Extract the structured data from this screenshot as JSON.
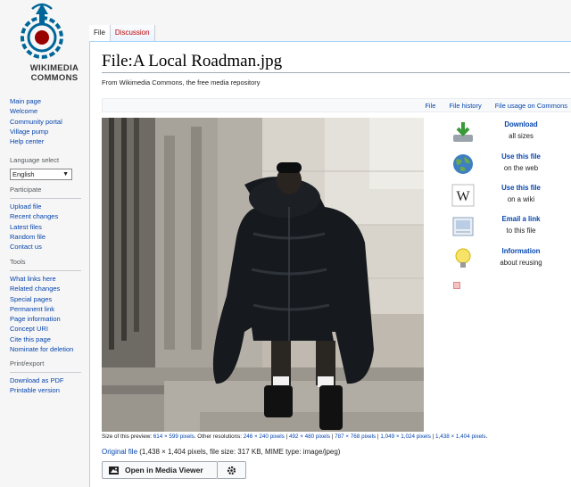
{
  "logo": {
    "text_line1": "WIKIMEDIA",
    "text_line2": "COMMONS"
  },
  "sidebar": {
    "main": [
      "Main page",
      "Welcome",
      "Community portal",
      "Village pump",
      "Help center"
    ],
    "language": {
      "heading": "Language select",
      "selected": "English"
    },
    "participate": {
      "heading": "Participate",
      "items": [
        "Upload file",
        "Recent changes",
        "Latest files",
        "Random file",
        "Contact us"
      ]
    },
    "tools": {
      "heading": "Tools",
      "items": [
        "What links here",
        "Related changes",
        "Special pages",
        "Permanent link",
        "Page information",
        "Concept URI",
        "Cite this page",
        "Nominate for deletion"
      ]
    },
    "printexport": {
      "heading": "Print/export",
      "items": [
        "Download as PDF",
        "Printable version"
      ]
    }
  },
  "tabs": [
    {
      "label": "File"
    },
    {
      "label": "Discussion"
    }
  ],
  "page": {
    "title": "File:A Local Roadman.jpg",
    "tagline": "From Wikimedia Commons, the free media repository"
  },
  "file_toc": [
    "File",
    "File history",
    "File usage on Commons"
  ],
  "actions": [
    {
      "title": "Download",
      "subtitle": "all sizes",
      "icon": "download-icon"
    },
    {
      "title": "Use this file",
      "subtitle": "on the web",
      "icon": "globe-icon"
    },
    {
      "title": "Use this file",
      "subtitle": "on a wiki",
      "icon": "wikipedia-icon"
    },
    {
      "title": "Email a link",
      "subtitle": "to this file",
      "icon": "email-icon"
    },
    {
      "title": "Information",
      "subtitle": "about reusing",
      "icon": "lightbulb-icon"
    }
  ],
  "size_line": {
    "label": "Size of this preview:",
    "preview": "614 × 599 pixels",
    "other": ". Other resolutions:",
    "res": [
      "246 × 240 pixels",
      "492 × 480 pixels",
      "787 × 768 pixels",
      "1,049 × 1,024 pixels",
      "1,438 × 1,404 pixels"
    ],
    "sep": " | ",
    "end": "."
  },
  "original": {
    "link": "Original file",
    "info": " (1,438 × 1,404 pixels, file size: 317 KB, MIME type: image/jpeg)"
  },
  "media_viewer": {
    "label": "Open in Media Viewer"
  },
  "colors": {
    "link": "#0645ad",
    "redlink": "#ba0000",
    "border": "#a7d7f9"
  }
}
